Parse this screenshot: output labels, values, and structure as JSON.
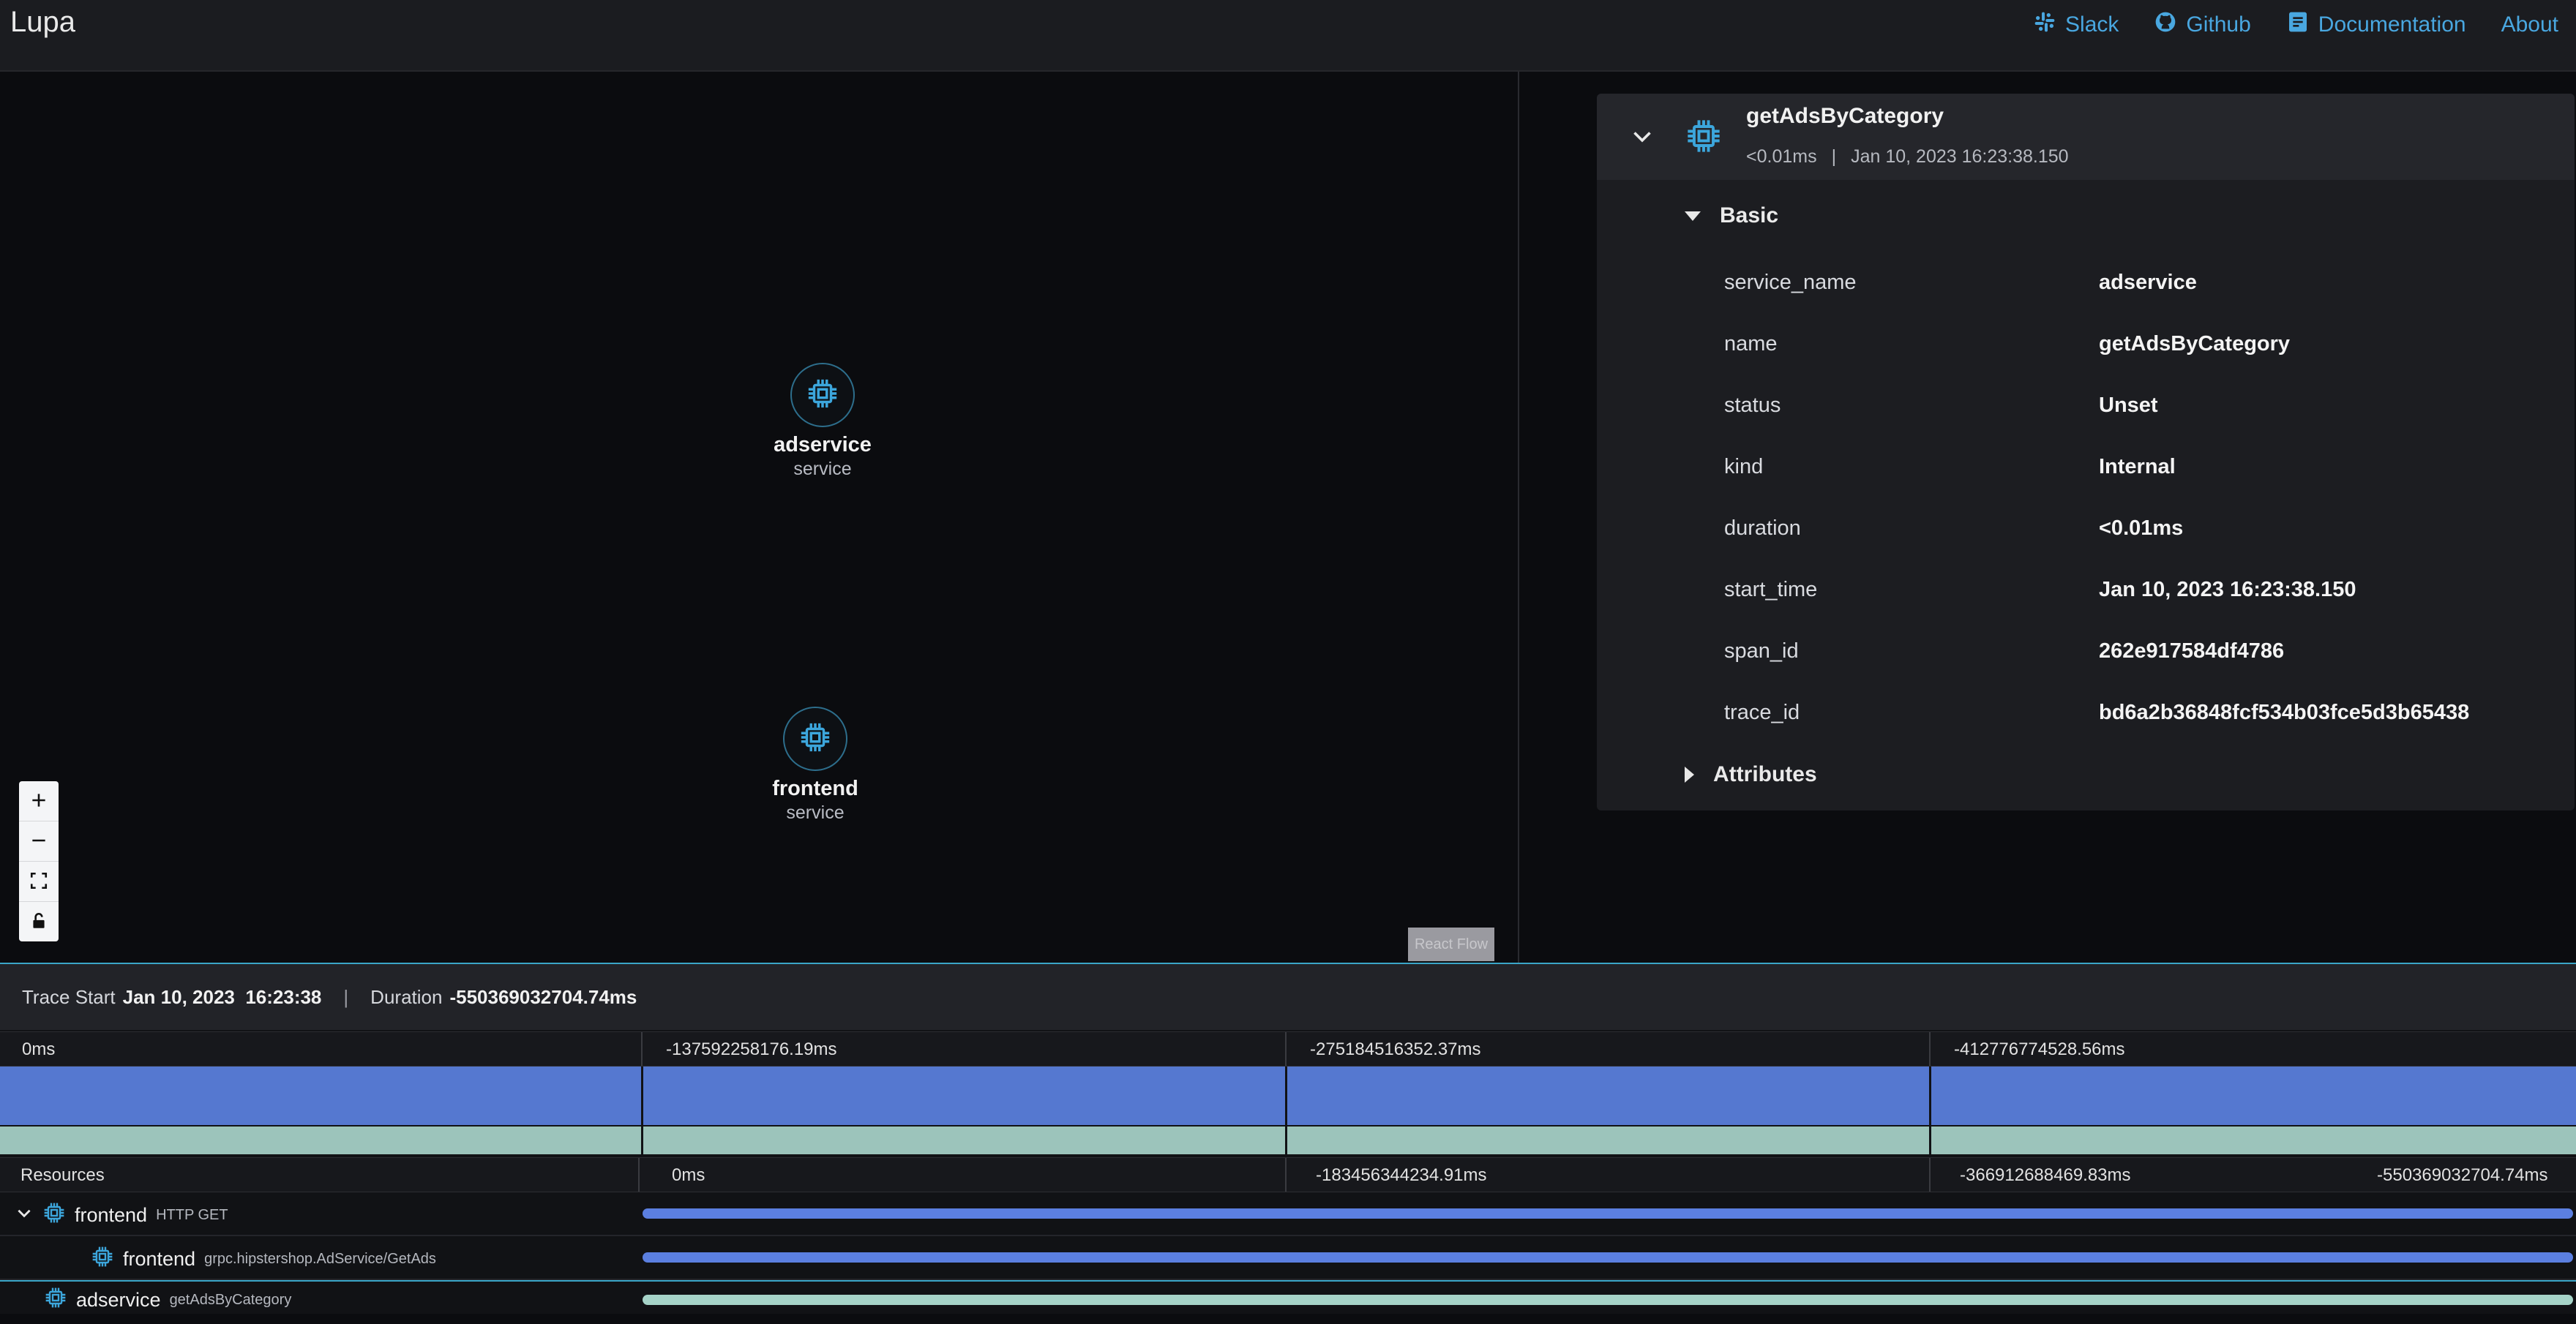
{
  "header": {
    "brand": "Lupa",
    "nav": [
      {
        "label": "Slack",
        "icon": "slack-icon"
      },
      {
        "label": "Github",
        "icon": "github-icon"
      },
      {
        "label": "Documentation",
        "icon": "documentation-icon"
      },
      {
        "label": "About",
        "icon": ""
      }
    ]
  },
  "graph": {
    "nodes": [
      {
        "name": "adservice",
        "type": "service"
      },
      {
        "name": "frontend",
        "type": "service"
      }
    ],
    "controls": [
      "zoom-in",
      "zoom-out",
      "fit-view",
      "lock"
    ],
    "attribution": "React Flow"
  },
  "span_panel": {
    "title": "getAdsByCategory",
    "duration": "<0.01ms",
    "separator": "|",
    "timestamp": "Jan 10, 2023 16:23:38.150",
    "basic_label": "Basic",
    "attributes_label": "Attributes",
    "fields": [
      {
        "key": "service_name",
        "value": "adservice"
      },
      {
        "key": "name",
        "value": "getAdsByCategory"
      },
      {
        "key": "status",
        "value": "Unset"
      },
      {
        "key": "kind",
        "value": "Internal"
      },
      {
        "key": "duration",
        "value": "<0.01ms"
      },
      {
        "key": "start_time",
        "value": "Jan 10, 2023 16:23:38.150"
      },
      {
        "key": "span_id",
        "value": "262e917584df4786"
      },
      {
        "key": "trace_id",
        "value": "bd6a2b36848fcf534b03fce5d3b65438"
      }
    ]
  },
  "trace": {
    "start_label": "Trace Start",
    "start_value": "Jan 10, 2023  16:23:38",
    "separator": "|",
    "duration_label": "Duration",
    "duration_value": "-550369032704.74ms",
    "top_ticks": [
      "0ms",
      "-137592258176.19ms",
      "-275184516352.37ms",
      "-412776774528.56ms"
    ],
    "bottom_ticks": [
      "0ms",
      "-183456344234.91ms",
      "-366912688469.83ms",
      "-550369032704.74ms"
    ],
    "resources_label": "Resources",
    "rows": [
      {
        "service": "frontend",
        "operation": "HTTP GET"
      },
      {
        "service": "frontend",
        "operation": "grpc.hipstershop.AdService/GetAds"
      },
      {
        "service": "adservice",
        "operation": "getAdsByCategory"
      }
    ]
  },
  "colors": {
    "accent": "#49a7e0",
    "bar_blue": "#5578d0",
    "bar_green": "#9cc4bb"
  }
}
